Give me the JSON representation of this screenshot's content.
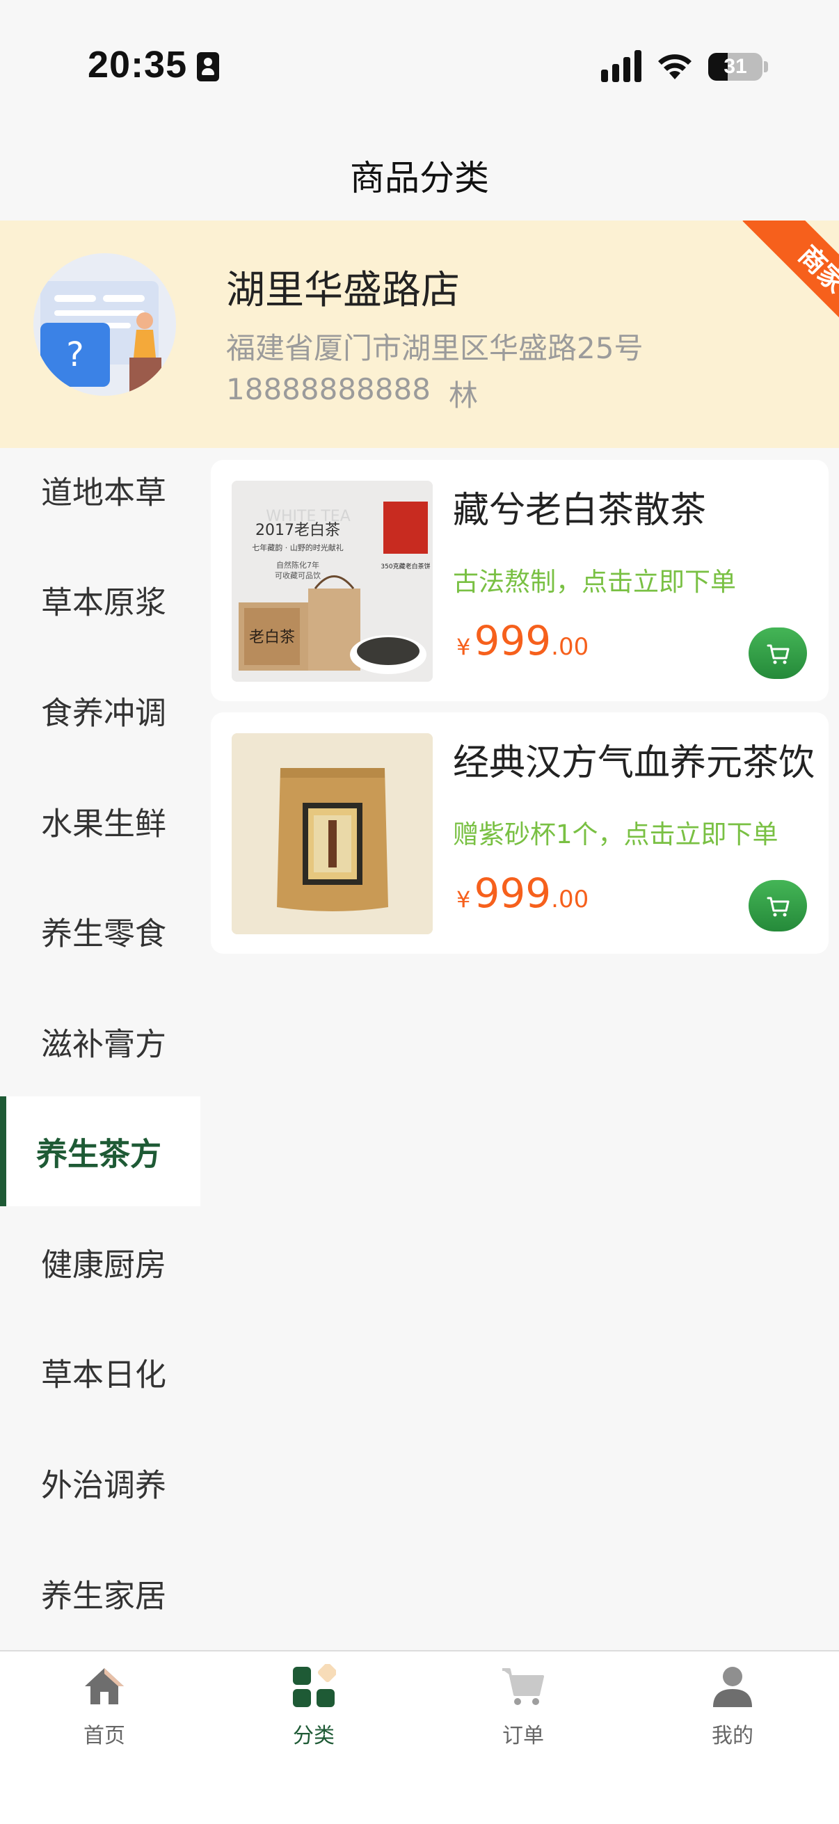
{
  "status_bar": {
    "time": "20:35",
    "battery": "31"
  },
  "page": {
    "title": "商品分类"
  },
  "store": {
    "name": "湖里华盛路店",
    "address": "福建省厦门市湖里区华盛路25号",
    "phone": "18888888888",
    "contact": "林",
    "badge": "商家"
  },
  "categories": [
    {
      "label": "道地本草"
    },
    {
      "label": "草本原浆"
    },
    {
      "label": "食养冲调"
    },
    {
      "label": "水果生鲜"
    },
    {
      "label": "养生零食"
    },
    {
      "label": "滋补膏方"
    },
    {
      "label": "养生茶方",
      "active": true
    },
    {
      "label": "健康厨房"
    },
    {
      "label": "草本日化"
    },
    {
      "label": "外治调养"
    },
    {
      "label": "养生家居"
    }
  ],
  "products": [
    {
      "name": "藏兮老白茶散茶",
      "desc": "古法熬制，点击立即下单",
      "price_currency": "¥",
      "price_int": "999",
      "price_dec": ".00",
      "image_text": {
        "brand": "WHITE TEA",
        "year": "2017老白茶",
        "line1": "七年藏韵 · 山野的时光献礼",
        "line2": "自然陈化7年",
        "line3": "可收藏可品饮",
        "box": "老白茶",
        "tag": "350克藏老白茶饼"
      }
    },
    {
      "name": "经典汉方气血养元茶饮",
      "desc": "赠紫砂杯1个，点击立即下单",
      "price_currency": "¥",
      "price_int": "999",
      "price_dec": ".00"
    }
  ],
  "tabbar": [
    {
      "label": "首页",
      "icon": "home-icon"
    },
    {
      "label": "分类",
      "icon": "category-icon",
      "active": true
    },
    {
      "label": "订单",
      "icon": "cart-icon"
    },
    {
      "label": "我的",
      "icon": "user-icon"
    }
  ],
  "colors": {
    "brand_green": "#1e5a35",
    "price_orange": "#f6601c",
    "desc_green": "#79c043",
    "store_bg": "#fcf1d3"
  }
}
